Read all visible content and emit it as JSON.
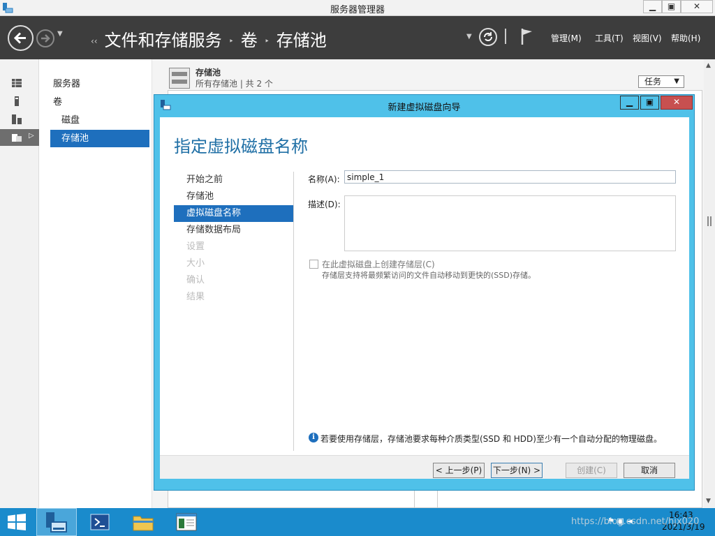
{
  "window": {
    "title": "服务器管理器",
    "min_glyph": "▁",
    "max_glyph": "▣",
    "close_glyph": "✕"
  },
  "header": {
    "breadcrumb": [
      "文件和存储服务",
      "卷",
      "存储池"
    ],
    "breadcrumb_prefix": "‹‹",
    "breadcrumb_sep": "‣",
    "menus": [
      "管理(M)",
      "工具(T)",
      "视图(V)",
      "帮助(H)"
    ]
  },
  "nav": {
    "items": [
      {
        "label": "服务器",
        "selected": false,
        "sub": false
      },
      {
        "label": "卷",
        "selected": false,
        "sub": false
      },
      {
        "label": "磁盘",
        "selected": false,
        "sub": true
      },
      {
        "label": "存储池",
        "selected": true,
        "sub": true
      }
    ]
  },
  "pool": {
    "title": "存储池",
    "subtitle": "所有存储池 | 共 2 个",
    "tasks_label": "任务"
  },
  "dialog": {
    "title": "新建虚拟磁盘向导",
    "heading": "指定虚拟磁盘名称",
    "steps": [
      {
        "label": "开始之前",
        "state": "normal"
      },
      {
        "label": "存储池",
        "state": "normal"
      },
      {
        "label": "虚拟磁盘名称",
        "state": "active"
      },
      {
        "label": "存储数据布局",
        "state": "normal"
      },
      {
        "label": "设置",
        "state": "dim"
      },
      {
        "label": "大小",
        "state": "dim"
      },
      {
        "label": "确认",
        "state": "dim"
      },
      {
        "label": "结果",
        "state": "dim"
      }
    ],
    "name_label": "名称(A):",
    "name_value": "simple_1",
    "desc_label": "描述(D):",
    "desc_value": "",
    "tier_checkbox_label": "在此虚拟磁盘上创建存储层(C)",
    "tier_checkbox_checked": false,
    "tier_desc": "存储层支持将最频繁访问的文件自动移动到更快的(SSD)存储。",
    "info_text": "若要使用存储层，存储池要求每种介质类型(SSD 和 HDD)至少有一个自动分配的物理磁盘。",
    "buttons": {
      "prev": "< 上一步(P)",
      "next": "下一步(N) >",
      "create": "创建(C)",
      "cancel": "取消"
    }
  },
  "taskbar": {
    "time": "16:43",
    "date": "2021/3/19",
    "watermark": "https://blog.csdn.net/hjx020"
  },
  "colors": {
    "header_bg": "#3d3d3d",
    "dialog_frame": "#4fc1e9",
    "selection": "#1e6fbd",
    "taskbar": "#1a8bcc"
  }
}
